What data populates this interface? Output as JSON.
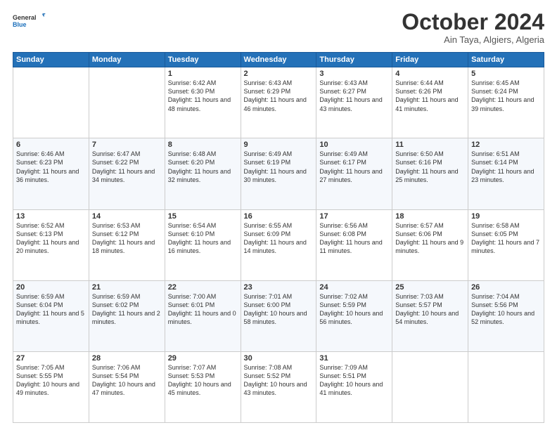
{
  "header": {
    "logo_general": "General",
    "logo_blue": "Blue",
    "month": "October 2024",
    "location": "Ain Taya, Algiers, Algeria"
  },
  "weekdays": [
    "Sunday",
    "Monday",
    "Tuesday",
    "Wednesday",
    "Thursday",
    "Friday",
    "Saturday"
  ],
  "weeks": [
    [
      {
        "day": "",
        "info": ""
      },
      {
        "day": "",
        "info": ""
      },
      {
        "day": "1",
        "info": "Sunrise: 6:42 AM\nSunset: 6:30 PM\nDaylight: 11 hours and 48 minutes."
      },
      {
        "day": "2",
        "info": "Sunrise: 6:43 AM\nSunset: 6:29 PM\nDaylight: 11 hours and 46 minutes."
      },
      {
        "day": "3",
        "info": "Sunrise: 6:43 AM\nSunset: 6:27 PM\nDaylight: 11 hours and 43 minutes."
      },
      {
        "day": "4",
        "info": "Sunrise: 6:44 AM\nSunset: 6:26 PM\nDaylight: 11 hours and 41 minutes."
      },
      {
        "day": "5",
        "info": "Sunrise: 6:45 AM\nSunset: 6:24 PM\nDaylight: 11 hours and 39 minutes."
      }
    ],
    [
      {
        "day": "6",
        "info": "Sunrise: 6:46 AM\nSunset: 6:23 PM\nDaylight: 11 hours and 36 minutes."
      },
      {
        "day": "7",
        "info": "Sunrise: 6:47 AM\nSunset: 6:22 PM\nDaylight: 11 hours and 34 minutes."
      },
      {
        "day": "8",
        "info": "Sunrise: 6:48 AM\nSunset: 6:20 PM\nDaylight: 11 hours and 32 minutes."
      },
      {
        "day": "9",
        "info": "Sunrise: 6:49 AM\nSunset: 6:19 PM\nDaylight: 11 hours and 30 minutes."
      },
      {
        "day": "10",
        "info": "Sunrise: 6:49 AM\nSunset: 6:17 PM\nDaylight: 11 hours and 27 minutes."
      },
      {
        "day": "11",
        "info": "Sunrise: 6:50 AM\nSunset: 6:16 PM\nDaylight: 11 hours and 25 minutes."
      },
      {
        "day": "12",
        "info": "Sunrise: 6:51 AM\nSunset: 6:14 PM\nDaylight: 11 hours and 23 minutes."
      }
    ],
    [
      {
        "day": "13",
        "info": "Sunrise: 6:52 AM\nSunset: 6:13 PM\nDaylight: 11 hours and 20 minutes."
      },
      {
        "day": "14",
        "info": "Sunrise: 6:53 AM\nSunset: 6:12 PM\nDaylight: 11 hours and 18 minutes."
      },
      {
        "day": "15",
        "info": "Sunrise: 6:54 AM\nSunset: 6:10 PM\nDaylight: 11 hours and 16 minutes."
      },
      {
        "day": "16",
        "info": "Sunrise: 6:55 AM\nSunset: 6:09 PM\nDaylight: 11 hours and 14 minutes."
      },
      {
        "day": "17",
        "info": "Sunrise: 6:56 AM\nSunset: 6:08 PM\nDaylight: 11 hours and 11 minutes."
      },
      {
        "day": "18",
        "info": "Sunrise: 6:57 AM\nSunset: 6:06 PM\nDaylight: 11 hours and 9 minutes."
      },
      {
        "day": "19",
        "info": "Sunrise: 6:58 AM\nSunset: 6:05 PM\nDaylight: 11 hours and 7 minutes."
      }
    ],
    [
      {
        "day": "20",
        "info": "Sunrise: 6:59 AM\nSunset: 6:04 PM\nDaylight: 11 hours and 5 minutes."
      },
      {
        "day": "21",
        "info": "Sunrise: 6:59 AM\nSunset: 6:02 PM\nDaylight: 11 hours and 2 minutes."
      },
      {
        "day": "22",
        "info": "Sunrise: 7:00 AM\nSunset: 6:01 PM\nDaylight: 11 hours and 0 minutes."
      },
      {
        "day": "23",
        "info": "Sunrise: 7:01 AM\nSunset: 6:00 PM\nDaylight: 10 hours and 58 minutes."
      },
      {
        "day": "24",
        "info": "Sunrise: 7:02 AM\nSunset: 5:59 PM\nDaylight: 10 hours and 56 minutes."
      },
      {
        "day": "25",
        "info": "Sunrise: 7:03 AM\nSunset: 5:57 PM\nDaylight: 10 hours and 54 minutes."
      },
      {
        "day": "26",
        "info": "Sunrise: 7:04 AM\nSunset: 5:56 PM\nDaylight: 10 hours and 52 minutes."
      }
    ],
    [
      {
        "day": "27",
        "info": "Sunrise: 7:05 AM\nSunset: 5:55 PM\nDaylight: 10 hours and 49 minutes."
      },
      {
        "day": "28",
        "info": "Sunrise: 7:06 AM\nSunset: 5:54 PM\nDaylight: 10 hours and 47 minutes."
      },
      {
        "day": "29",
        "info": "Sunrise: 7:07 AM\nSunset: 5:53 PM\nDaylight: 10 hours and 45 minutes."
      },
      {
        "day": "30",
        "info": "Sunrise: 7:08 AM\nSunset: 5:52 PM\nDaylight: 10 hours and 43 minutes."
      },
      {
        "day": "31",
        "info": "Sunrise: 7:09 AM\nSunset: 5:51 PM\nDaylight: 10 hours and 41 minutes."
      },
      {
        "day": "",
        "info": ""
      },
      {
        "day": "",
        "info": ""
      }
    ]
  ]
}
